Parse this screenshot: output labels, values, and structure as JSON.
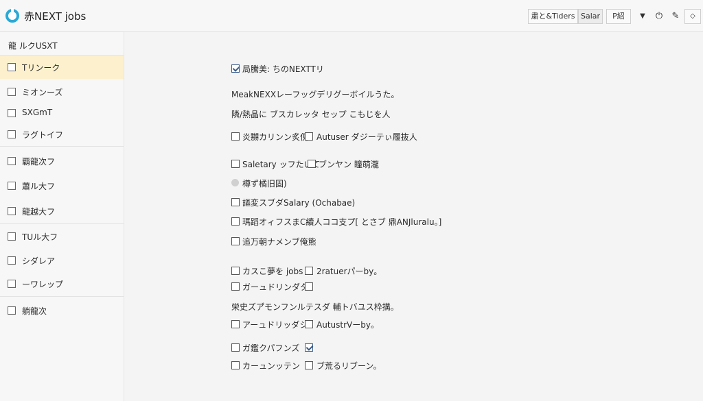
{
  "app": {
    "title": "赤NEXT jobs"
  },
  "toolbar": {
    "btn1": "粛と&Tiders",
    "btn2": "Salar",
    "btn3": "P紹",
    "icons": [
      "dropdown-arrow-icon",
      "power-icon",
      "pencil-icon",
      "settings-icon"
    ]
  },
  "sidebar": {
    "header": "龍 ルクUSXT",
    "items": [
      {
        "label": "Tリンーク",
        "active": true
      },
      {
        "label": "ミオンーズ"
      },
      {
        "label": "SXGmT"
      },
      {
        "label": "ラグトイフ"
      },
      {
        "label": "覇龍次フ"
      },
      {
        "label": "蕭ル大フ"
      },
      {
        "label": "龍越大フ"
      },
      {
        "label": "TUル大フ"
      },
      {
        "label": "シダレア"
      },
      {
        "label": "ーワレップ"
      },
      {
        "label": "躺龍次"
      }
    ]
  },
  "main": {
    "row1": "局騰美: ちのNEXTTリ",
    "text1": "MeakNEXXレーフッグデリグーボイルうた。",
    "text2": "隣/熱晶に ブスカレッタ セップ こもじを人",
    "row3a": "炎嬲カリンン炙俔",
    "row3b": "Autuser ダジーテぃ履抜人",
    "row4a": "Saletary ッフたいて",
    "row4b": "ブンヤン 瞳萌瀧",
    "radio": "樽ず橘旧固)",
    "row6": "謳変スブダSalary (Ochabae)",
    "row7": "瑪蹈オィフスまC續人ココ支プ[ とさブ 鼎ANJluralu。]",
    "row8": "追万朝ナメンブ俺熊",
    "row9a": "カスこ夢を jobs",
    "row9b": "2ratuerパーby。",
    "row10a": "ガーュドリンダタ",
    "text3": "栄史ズア゙モンフンルテスダ 輔トバユス枠搆。",
    "row11a": "アーュドリッダシ",
    "row11b": "AutustrVーby。",
    "row12a": "ガ鑑クパフンズ",
    "row13a": "カーュンッテン",
    "row13b": "ブ荒るリブーン。"
  }
}
